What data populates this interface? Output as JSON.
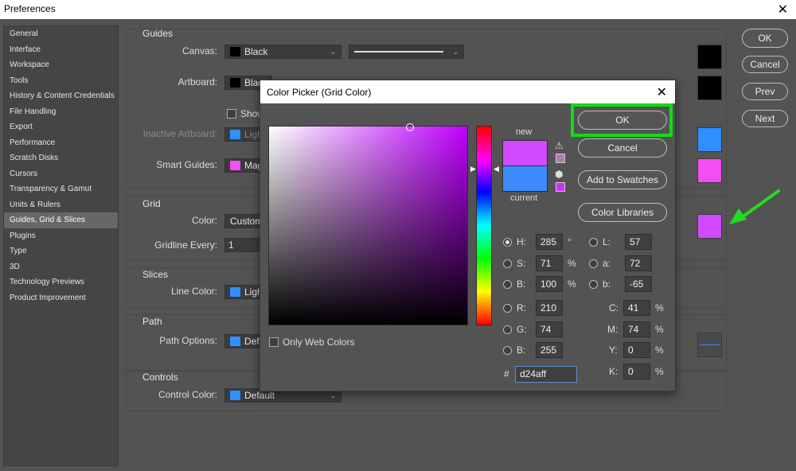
{
  "window": {
    "title": "Preferences",
    "close": "✕"
  },
  "sidebar": {
    "items": [
      "General",
      "Interface",
      "Workspace",
      "Tools",
      "History & Content Credentials",
      "File Handling",
      "Export",
      "Performance",
      "Scratch Disks",
      "Cursors",
      "Transparency & Gamut",
      "Units & Rulers",
      "Guides, Grid & Slices",
      "Plugins",
      "Type",
      "3D",
      "Technology Previews",
      "Product Improvement"
    ],
    "selected": "Guides, Grid & Slices"
  },
  "buttons": {
    "ok": "OK",
    "cancel": "Cancel",
    "prev": "Prev",
    "next": "Next"
  },
  "guides": {
    "title": "Guides",
    "canvas_label": "Canvas:",
    "canvas_value": "Black",
    "artboard_label": "Artboard:",
    "artboard_value": "Black",
    "show_label": "Show",
    "inactive_label": "Inactive Artboard:",
    "inactive_value": "Ligh",
    "smart_label": "Smart Guides:",
    "smart_value": "Mag"
  },
  "grid": {
    "title": "Grid",
    "color_label": "Color:",
    "color_value": "Custom",
    "every_label": "Gridline Every:",
    "every_value": "1"
  },
  "slices": {
    "title": "Slices",
    "line_label": "Line Color:",
    "line_value": "Ligh"
  },
  "path": {
    "title": "Path",
    "options_label": "Path Options:",
    "options_value": "Defa"
  },
  "controls": {
    "title": "Controls",
    "color_label": "Control Color:",
    "color_value": "Default"
  },
  "colors": {
    "black": "#000000",
    "light_blue": "#2f8fff",
    "magenta": "#f24ef2",
    "grid_color": "#d24aff",
    "arrow": "#22dd22"
  },
  "picker": {
    "title": "Color Picker (Grid Color)",
    "close": "✕",
    "new_label": "new",
    "current_label": "current",
    "new_color": "#d24aff",
    "current_color": "#3d8cff",
    "ok": "OK",
    "cancel": "Cancel",
    "add": "Add to Swatches",
    "libraries": "Color Libraries",
    "only_web": "Only Web Colors",
    "H": "285",
    "S": "71",
    "B": "100",
    "R": "210",
    "G": "74",
    "Bv": "255",
    "L": "57",
    "a": "72",
    "b": "-65",
    "C": "41",
    "M": "74",
    "Y": "0",
    "K": "0",
    "hex": "d24aff",
    "labels": {
      "H": "H:",
      "S": "S:",
      "B": "B:",
      "R": "R:",
      "G": "G:",
      "B2": "B:",
      "L": "L:",
      "a": "a:",
      "b": "b:",
      "C": "C:",
      "M": "M:",
      "Y": "Y:",
      "K": "K:",
      "hash": "#"
    },
    "units": {
      "deg": "°",
      "pct": "%"
    }
  }
}
